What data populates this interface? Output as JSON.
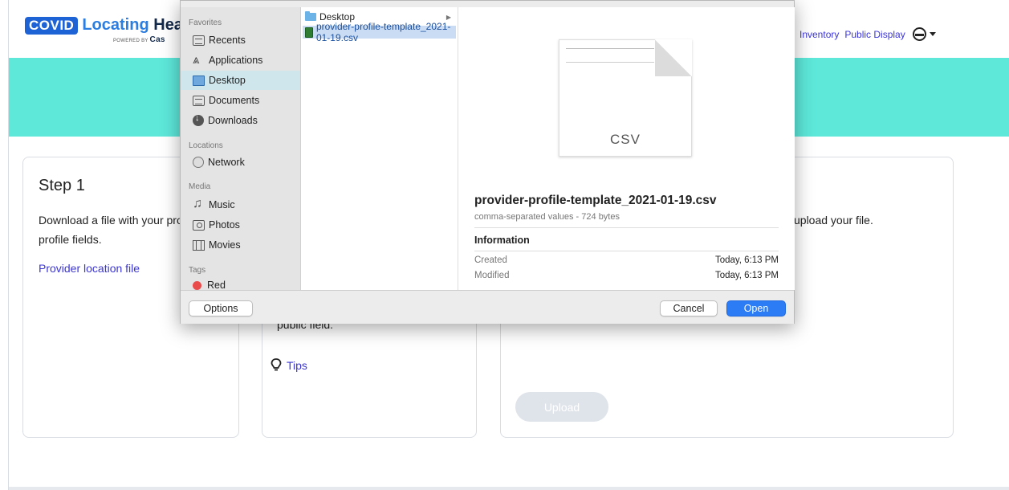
{
  "app": {
    "logo_badge": "COVID",
    "logo_text_blue": "Locating",
    "logo_text_dark": " Hea",
    "logo_sub": "POWERED BY",
    "logo_sub_brand": "Cas",
    "nav": {
      "inventory": "Inventory",
      "public_display": "Public Display"
    },
    "banner_color": "#5de8da"
  },
  "cards": {
    "step1": {
      "title": "Step 1",
      "text": "Download a file with your provider profile fields.",
      "link": "Provider location file"
    },
    "step2": {
      "text": "public field.",
      "tips": "Tips"
    },
    "step3": {
      "text": "upload your file.",
      "upload": "Upload"
    }
  },
  "dialog": {
    "sidebar": {
      "favorites_header": "Favorites",
      "favorites": [
        {
          "label": "Recents",
          "icon": "recents-icon"
        },
        {
          "label": "Applications",
          "icon": "applications-icon"
        },
        {
          "label": "Desktop",
          "icon": "desktop-icon",
          "selected": true
        },
        {
          "label": "Documents",
          "icon": "documents-icon"
        },
        {
          "label": "Downloads",
          "icon": "downloads-icon"
        }
      ],
      "locations_header": "Locations",
      "locations": [
        {
          "label": "Network",
          "icon": "network-icon"
        }
      ],
      "media_header": "Media",
      "media": [
        {
          "label": "Music",
          "icon": "music-icon"
        },
        {
          "label": "Photos",
          "icon": "camera-icon"
        },
        {
          "label": "Movies",
          "icon": "film-icon"
        }
      ],
      "tags_header": "Tags",
      "tags": [
        {
          "label": "Red",
          "color": "#e94b4b"
        }
      ]
    },
    "column": {
      "folder": "Desktop",
      "file": "provider-profile-template_2021-01-19.csv"
    },
    "preview": {
      "thumb_label": "CSV",
      "file_name": "provider-profile-template_2021-01-19.csv",
      "file_desc": "comma-separated values - 724 bytes",
      "info_header": "Information",
      "created_label": "Created",
      "created_value": "Today, 6:13 PM",
      "modified_label": "Modified",
      "modified_value": "Today, 6:13 PM"
    },
    "buttons": {
      "options": "Options",
      "cancel": "Cancel",
      "open": "Open"
    },
    "accent_color": "#2c7cf6"
  }
}
